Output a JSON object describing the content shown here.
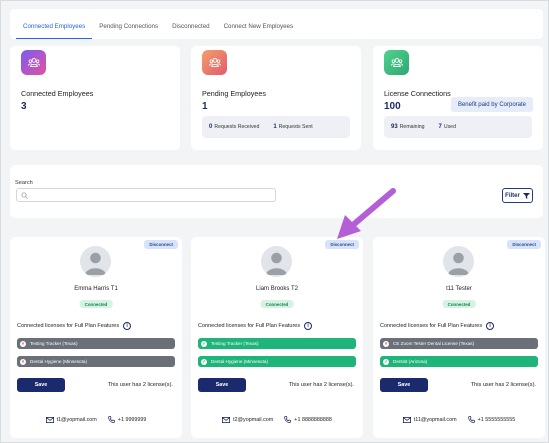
{
  "tabs": [
    {
      "label": "Connected Employees",
      "active": true
    },
    {
      "label": "Pending Connections",
      "active": false
    },
    {
      "label": "Disconnected",
      "active": false
    },
    {
      "label": "Connect New Employees",
      "active": false
    }
  ],
  "stats": {
    "connected": {
      "title": "Connected Employees",
      "value": "3",
      "icon": "people-icon",
      "color_from": "#7b5cf0",
      "color_to": "#e052a0"
    },
    "pending": {
      "title": "Pending Employees",
      "value": "1",
      "icon": "people-icon",
      "color_from": "#f3a06a",
      "color_to": "#e25a6d",
      "requests_received_count": "0",
      "requests_received_label": "Requests Received",
      "requests_sent_count": "1",
      "requests_sent_label": "Requests Sent"
    },
    "license": {
      "title": "License Connections",
      "value": "100",
      "icon": "people-icon",
      "color_from": "#54d18c",
      "color_to": "#2ba872",
      "corporate_badge": "Benefit paid by Corporate",
      "remaining_count": "93",
      "remaining_label": "Remaining",
      "used_count": "7",
      "used_label": "Used"
    }
  },
  "search": {
    "label": "Search",
    "placeholder": "",
    "value": ""
  },
  "filter": {
    "label": "Filter"
  },
  "employees": [
    {
      "name": "Emma Harris T1",
      "status": "Connected",
      "disconnect_label": "Disconnect",
      "licenses_title": "Connected licenses for Full Plan Features",
      "licenses": [
        {
          "label": "Testing Tracker (Texas)",
          "enabled": false
        },
        {
          "label": "Dental Hygiene (Minnesota)",
          "enabled": false
        }
      ],
      "save_label": "Save",
      "license_count_text": "This user has 2 license(s).",
      "email": "t1@yopmail.com",
      "phone": "+1 9999999"
    },
    {
      "name": "Liam Brooks T2",
      "status": "Connected",
      "disconnect_label": "Disconnect",
      "licenses_title": "Connected licenses for Full Plan Features",
      "licenses": [
        {
          "label": "Testing Tracker (Texas)",
          "enabled": true
        },
        {
          "label": "Dental Hygiene (Minnesota)",
          "enabled": true
        }
      ],
      "save_label": "Save",
      "license_count_text": "This user has 2 license(s).",
      "email": "t2@yopmail.com",
      "phone": "+1 8888888888"
    },
    {
      "name": "t11 Tester",
      "status": "Connected",
      "disconnect_label": "Disconnect",
      "licenses_title": "Connected licenses for Full Plan Features",
      "licenses": [
        {
          "label": "CE Zoom Tester Dental License (Texas)",
          "enabled": false
        },
        {
          "label": "Dentist (Arizona)",
          "enabled": true
        }
      ],
      "save_label": "Save",
      "license_count_text": "This user has 2 license(s).",
      "email": "t11@yopmail.com",
      "phone": "+1 5555555555"
    }
  ],
  "colors": {
    "accent": "#2563eb",
    "navy": "#1a2a6c",
    "license_enabled": "#1fb47a",
    "license_disabled": "#6b6f77",
    "annotation_arrow": "#b35fd6"
  }
}
